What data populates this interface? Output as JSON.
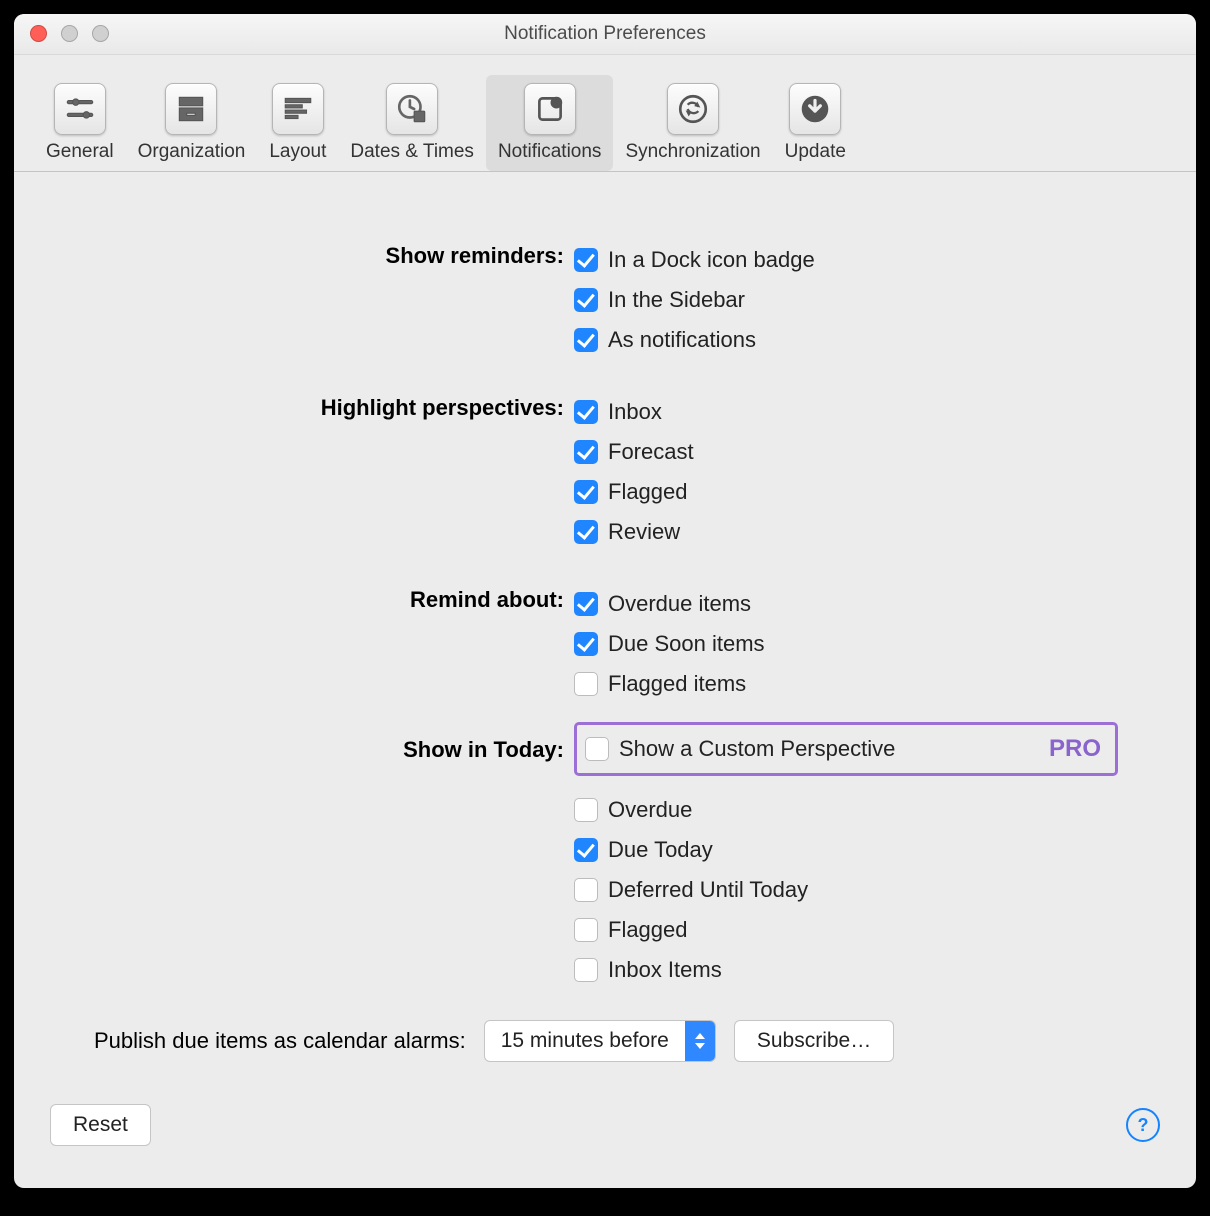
{
  "window": {
    "title": "Notification Preferences"
  },
  "toolbar": {
    "items": [
      {
        "label": "General"
      },
      {
        "label": "Organization"
      },
      {
        "label": "Layout"
      },
      {
        "label": "Dates & Times"
      },
      {
        "label": "Notifications"
      },
      {
        "label": "Synchronization"
      },
      {
        "label": "Update"
      }
    ],
    "active_index": 4
  },
  "sections": {
    "show_reminders": {
      "label": "Show reminders:",
      "items": [
        {
          "label": "In a Dock icon badge",
          "checked": true
        },
        {
          "label": "In the Sidebar",
          "checked": true
        },
        {
          "label": "As notifications",
          "checked": true
        }
      ]
    },
    "highlight": {
      "label": "Highlight perspectives:",
      "items": [
        {
          "label": "Inbox",
          "checked": true
        },
        {
          "label": "Forecast",
          "checked": true
        },
        {
          "label": "Flagged",
          "checked": true
        },
        {
          "label": "Review",
          "checked": true
        }
      ]
    },
    "remind_about": {
      "label": "Remind about:",
      "items": [
        {
          "label": "Overdue items",
          "checked": true
        },
        {
          "label": "Due Soon items",
          "checked": true
        },
        {
          "label": "Flagged items",
          "checked": false
        }
      ]
    },
    "show_in_today": {
      "label": "Show in Today:",
      "pro": {
        "label": "Show a Custom Perspective",
        "checked": false,
        "badge": "PRO"
      },
      "items": [
        {
          "label": "Overdue",
          "checked": false
        },
        {
          "label": "Due Today",
          "checked": true
        },
        {
          "label": "Deferred Until Today",
          "checked": false
        },
        {
          "label": "Flagged",
          "checked": false
        },
        {
          "label": "Inbox Items",
          "checked": false
        }
      ]
    }
  },
  "publish": {
    "label": "Publish due items as calendar alarms:",
    "select_value": "15 minutes before",
    "subscribe": "Subscribe…"
  },
  "footer": {
    "reset": "Reset"
  }
}
